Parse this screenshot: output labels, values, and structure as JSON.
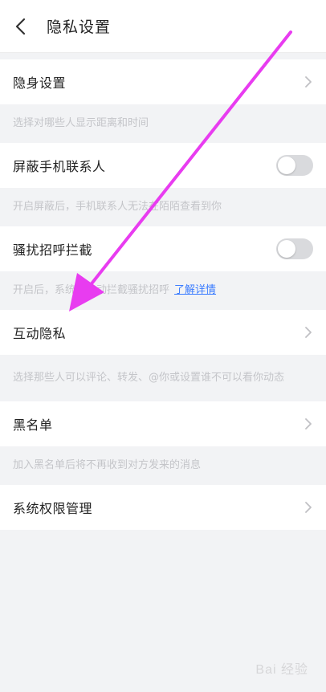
{
  "header": {
    "title": "隐私设置"
  },
  "items": [
    {
      "label": "隐身设置",
      "desc": "选择对哪些人显示距离和时间"
    },
    {
      "label": "屏蔽手机联系人",
      "desc": "开启屏蔽后，手机联系人无法在陌陌查看到你",
      "toggle": false
    },
    {
      "label": "骚扰招呼拦截",
      "desc": "开启后，系统将自动拦截骚扰招呼",
      "link": "了解详情",
      "toggle": false
    },
    {
      "label": "互动隐私",
      "desc": "选择那些人可以评论、转发、@你或设置谁不可以看你动态"
    },
    {
      "label": "黑名单",
      "desc": "加入黑名单后将不再收到对方发来的消息"
    },
    {
      "label": "系统权限管理"
    }
  ],
  "watermark": "Bai 经验",
  "colors": {
    "annotation_arrow": "#e83cf0",
    "link": "#3b7cff",
    "toggle_off": "#d9dadd"
  }
}
